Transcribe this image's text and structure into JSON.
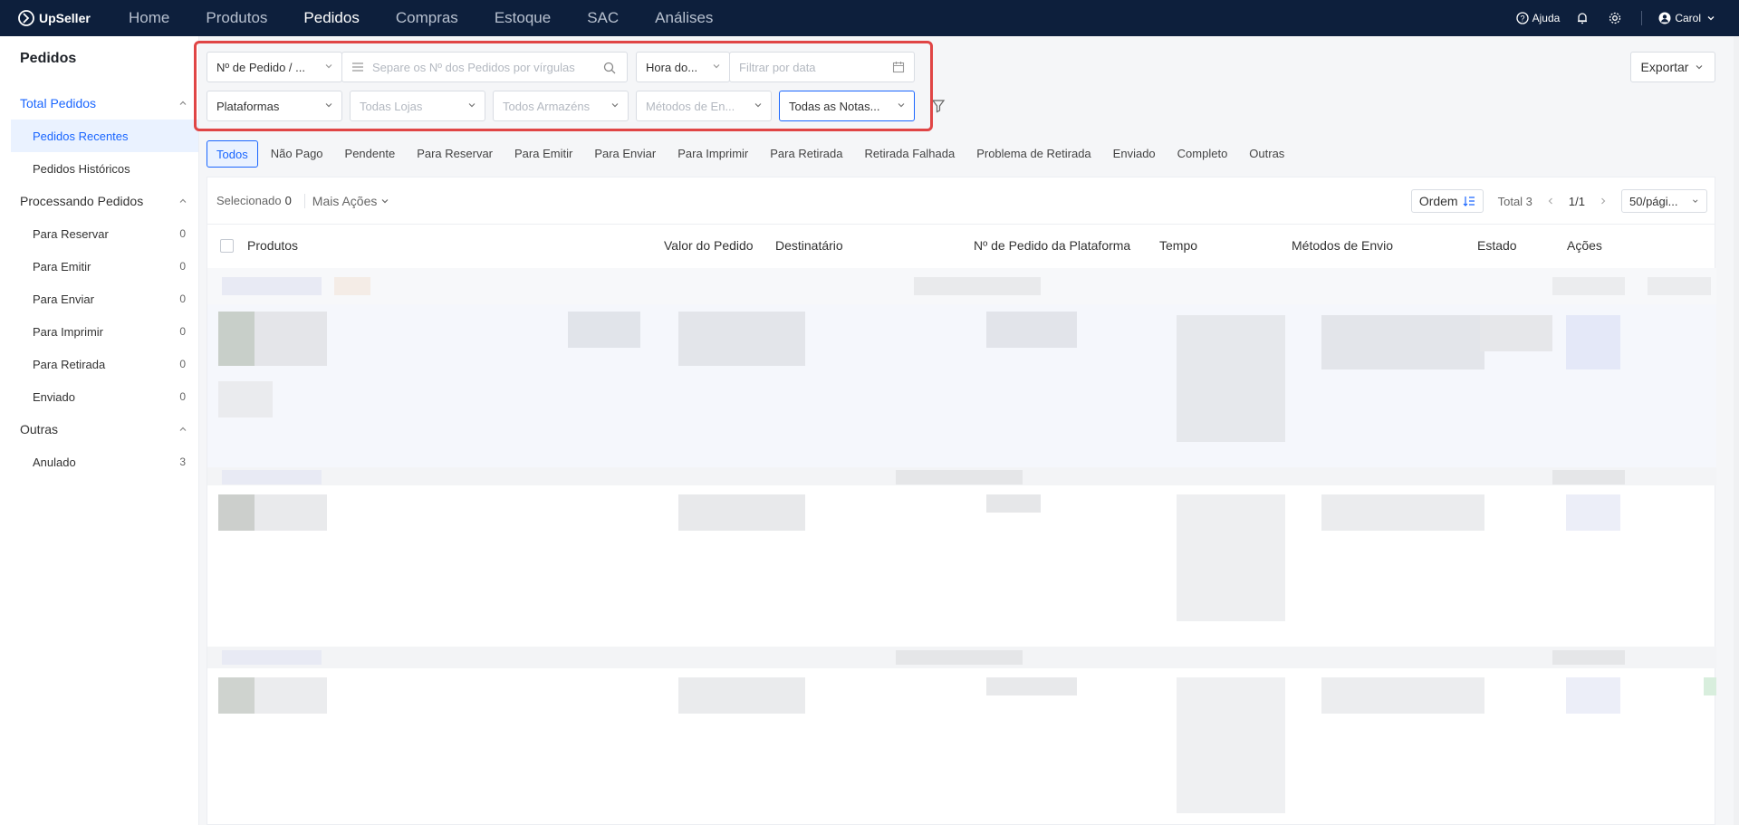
{
  "brand": {
    "name": "UpSeller"
  },
  "nav": {
    "items": [
      "Home",
      "Produtos",
      "Pedidos",
      "Compras",
      "Estoque",
      "SAC",
      "Análises"
    ],
    "active": "Pedidos"
  },
  "topright": {
    "help": "Ajuda",
    "user": "Carol"
  },
  "sidebar": {
    "title": "Pedidos",
    "total_group": "Total Pedidos",
    "recent": "Pedidos Recentes",
    "historic": "Pedidos Históricos",
    "processing_group": "Processando Pedidos",
    "processing_items": [
      {
        "label": "Para Reservar",
        "count": "0"
      },
      {
        "label": "Para Emitir",
        "count": "0"
      },
      {
        "label": "Para Enviar",
        "count": "0"
      },
      {
        "label": "Para Imprimir",
        "count": "0"
      },
      {
        "label": "Para Retirada",
        "count": "0"
      },
      {
        "label": "Enviado",
        "count": "0"
      }
    ],
    "other_group": "Outras",
    "other_items": [
      {
        "label": "Anulado",
        "count": "3"
      }
    ]
  },
  "filters": {
    "order_type": "Nº de Pedido / ...",
    "search_placeholder": "Separe os Nº dos Pedidos por vírgulas",
    "time_type": "Hora do...",
    "date_placeholder": "Filtrar por data",
    "platforms": "Plataformas",
    "stores": "Todas Lojas",
    "warehouses": "Todos Armazéns",
    "shipping": "Métodos de En...",
    "invoices": "Todas as Notas..."
  },
  "export_label": "Exportar",
  "tabs": [
    "Todos",
    "Não Pago",
    "Pendente",
    "Para Reservar",
    "Para Emitir",
    "Para Enviar",
    "Para Imprimir",
    "Para Retirada",
    "Retirada Falhada",
    "Problema de Retirada",
    "Enviado",
    "Completo",
    "Outras"
  ],
  "toolbar": {
    "selected_label": "Selecionado",
    "selected_count": "0",
    "more_actions": "Mais Ações",
    "order_label": "Ordem",
    "total": "Total 3",
    "page": "1/1",
    "page_size": "50/pági..."
  },
  "columns": [
    "Produtos",
    "Valor do Pedido",
    "Destinatário",
    "Nº de Pedido da Plataforma",
    "Tempo",
    "Métodos de Envio",
    "Estado",
    "Ações"
  ],
  "colors": {
    "accent": "#1a66ff",
    "topbar": "#0d1f3c",
    "highlight": "#e04545"
  }
}
